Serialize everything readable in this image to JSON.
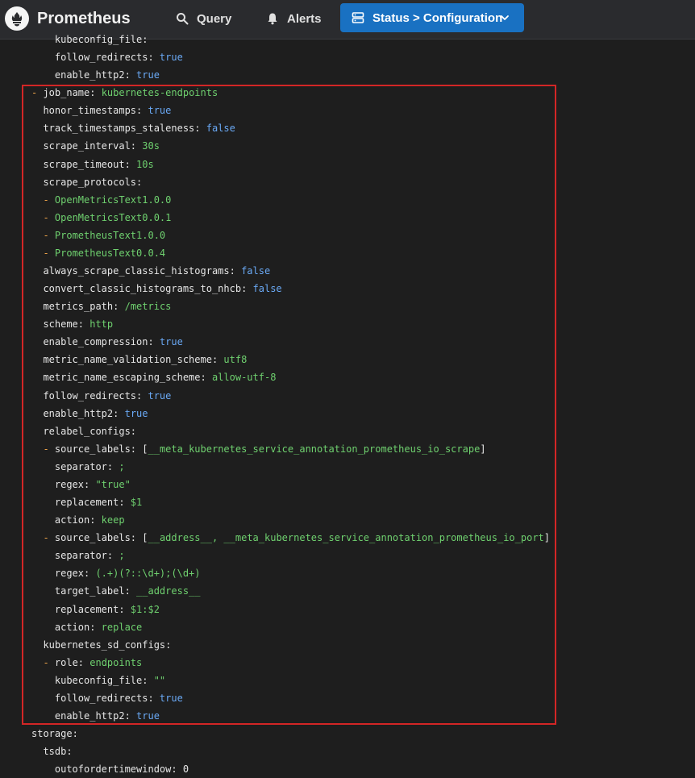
{
  "app": {
    "brand": "Prometheus",
    "nav": [
      {
        "label": "Query",
        "icon": "search-icon"
      },
      {
        "label": "Alerts",
        "icon": "bell-icon"
      }
    ],
    "status_button": {
      "label": "Status > Configuration",
      "icon": "server-icon",
      "caret": "chevron-down-icon"
    },
    "colors": {
      "navbar": "#2a2b2e",
      "accent": "#1971c2",
      "background": "#1e1e1e",
      "highlight": "#d32626"
    }
  },
  "config_lines": [
    {
      "indent": 4,
      "dash": false,
      "key": "kubeconfig_file:",
      "value": "",
      "vtype": "s"
    },
    {
      "indent": 4,
      "dash": false,
      "key": "follow_redirects:",
      "value": "true",
      "vtype": "b"
    },
    {
      "indent": 4,
      "dash": false,
      "key": "enable_http2:",
      "value": "true",
      "vtype": "b"
    },
    {
      "indent": 0,
      "dash": true,
      "key": "job_name:",
      "value": "kubernetes-endpoints",
      "vtype": "s"
    },
    {
      "indent": 2,
      "dash": false,
      "key": "honor_timestamps:",
      "value": "true",
      "vtype": "b"
    },
    {
      "indent": 2,
      "dash": false,
      "key": "track_timestamps_staleness:",
      "value": "false",
      "vtype": "b"
    },
    {
      "indent": 2,
      "dash": false,
      "key": "scrape_interval:",
      "value": "30s",
      "vtype": "s"
    },
    {
      "indent": 2,
      "dash": false,
      "key": "scrape_timeout:",
      "value": "10s",
      "vtype": "s"
    },
    {
      "indent": 2,
      "dash": false,
      "key": "scrape_protocols:",
      "value": "",
      "vtype": "s"
    },
    {
      "indent": 2,
      "dash": true,
      "key": "",
      "value": "OpenMetricsText1.0.0",
      "vtype": "s"
    },
    {
      "indent": 2,
      "dash": true,
      "key": "",
      "value": "OpenMetricsText0.0.1",
      "vtype": "s"
    },
    {
      "indent": 2,
      "dash": true,
      "key": "",
      "value": "PrometheusText1.0.0",
      "vtype": "s"
    },
    {
      "indent": 2,
      "dash": true,
      "key": "",
      "value": "PrometheusText0.0.4",
      "vtype": "s"
    },
    {
      "indent": 2,
      "dash": false,
      "key": "always_scrape_classic_histograms:",
      "value": "false",
      "vtype": "b"
    },
    {
      "indent": 2,
      "dash": false,
      "key": "convert_classic_histograms_to_nhcb:",
      "value": "false",
      "vtype": "b"
    },
    {
      "indent": 2,
      "dash": false,
      "key": "metrics_path:",
      "value": "/metrics",
      "vtype": "s"
    },
    {
      "indent": 2,
      "dash": false,
      "key": "scheme:",
      "value": "http",
      "vtype": "s"
    },
    {
      "indent": 2,
      "dash": false,
      "key": "enable_compression:",
      "value": "true",
      "vtype": "b"
    },
    {
      "indent": 2,
      "dash": false,
      "key": "metric_name_validation_scheme:",
      "value": "utf8",
      "vtype": "s"
    },
    {
      "indent": 2,
      "dash": false,
      "key": "metric_name_escaping_scheme:",
      "value": "allow-utf-8",
      "vtype": "s"
    },
    {
      "indent": 2,
      "dash": false,
      "key": "follow_redirects:",
      "value": "true",
      "vtype": "b"
    },
    {
      "indent": 2,
      "dash": false,
      "key": "enable_http2:",
      "value": "true",
      "vtype": "b"
    },
    {
      "indent": 2,
      "dash": false,
      "key": "relabel_configs:",
      "value": "",
      "vtype": "s"
    },
    {
      "indent": 2,
      "dash": true,
      "key": "source_labels:",
      "value": "[__meta_kubernetes_service_annotation_prometheus_io_scrape]",
      "vtype": "list"
    },
    {
      "indent": 4,
      "dash": false,
      "key": "separator:",
      "value": ";",
      "vtype": "s"
    },
    {
      "indent": 4,
      "dash": false,
      "key": "regex:",
      "value": "\"true\"",
      "vtype": "s"
    },
    {
      "indent": 4,
      "dash": false,
      "key": "replacement:",
      "value": "$1",
      "vtype": "s"
    },
    {
      "indent": 4,
      "dash": false,
      "key": "action:",
      "value": "keep",
      "vtype": "s"
    },
    {
      "indent": 2,
      "dash": true,
      "key": "source_labels:",
      "value": "[__address__, __meta_kubernetes_service_annotation_prometheus_io_port]",
      "vtype": "list"
    },
    {
      "indent": 4,
      "dash": false,
      "key": "separator:",
      "value": ";",
      "vtype": "s"
    },
    {
      "indent": 4,
      "dash": false,
      "key": "regex:",
      "value": "(.+)(?::\\d+);(\\d+)",
      "vtype": "s"
    },
    {
      "indent": 4,
      "dash": false,
      "key": "target_label:",
      "value": "__address__",
      "vtype": "s"
    },
    {
      "indent": 4,
      "dash": false,
      "key": "replacement:",
      "value": "$1:$2",
      "vtype": "s"
    },
    {
      "indent": 4,
      "dash": false,
      "key": "action:",
      "value": "replace",
      "vtype": "s"
    },
    {
      "indent": 2,
      "dash": false,
      "key": "kubernetes_sd_configs:",
      "value": "",
      "vtype": "s"
    },
    {
      "indent": 2,
      "dash": true,
      "key": "role:",
      "value": "endpoints",
      "vtype": "s"
    },
    {
      "indent": 4,
      "dash": false,
      "key": "kubeconfig_file:",
      "value": "\"\"",
      "vtype": "s"
    },
    {
      "indent": 4,
      "dash": false,
      "key": "follow_redirects:",
      "value": "true",
      "vtype": "b"
    },
    {
      "indent": 4,
      "dash": false,
      "key": "enable_http2:",
      "value": "true",
      "vtype": "b"
    },
    {
      "indent": 0,
      "dash": false,
      "key": "storage:",
      "value": "",
      "vtype": "s"
    },
    {
      "indent": 2,
      "dash": false,
      "key": "tsdb:",
      "value": "",
      "vtype": "s"
    },
    {
      "indent": 4,
      "dash": false,
      "key": "outofordertimewindow:",
      "value": "0",
      "vtype": "n"
    }
  ]
}
